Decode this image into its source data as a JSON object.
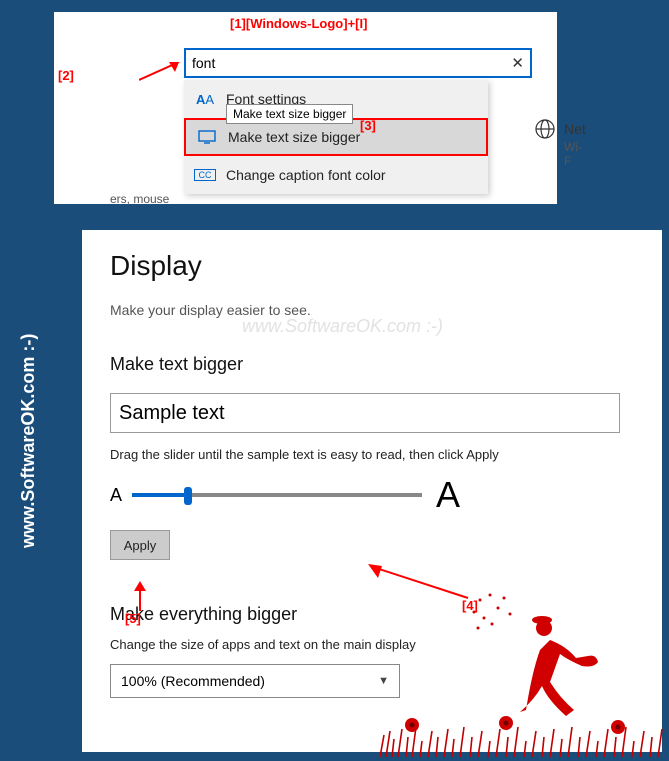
{
  "annotations": {
    "a1": "[1][Windows-Logo]+[I]",
    "a2": "[2]",
    "a3": "[3]",
    "a4": "[4]",
    "a5": "[5]"
  },
  "search": {
    "value": "font",
    "clear_symbol": "✕",
    "tooltip": "Make text size bigger",
    "results": {
      "r1": "Font settings",
      "r2": "Make text size bigger",
      "r3": "Change caption font color"
    }
  },
  "hints": {
    "net": "Net",
    "wifi": "Wi-F",
    "mouse": "ers, mouse"
  },
  "display": {
    "title": "Display",
    "subtitle": "Make your display easier to see.",
    "watermark": "www.SoftwareOK.com :-)",
    "make_text_bigger": "Make text bigger",
    "sample_value": "Sample text",
    "drag_instruction": "Drag the slider until the sample text is easy to read, then click Apply",
    "small_a": "A",
    "big_a": "A",
    "apply": "Apply",
    "make_everything_bigger": "Make everything bigger",
    "everything_desc": "Change the size of apps and text on the main display",
    "scale_value": "100% (Recommended)"
  },
  "brand": "www.SoftwareOK.com :-)"
}
